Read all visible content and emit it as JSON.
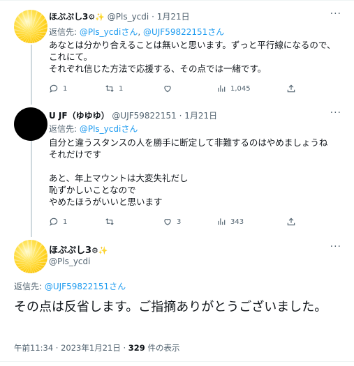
{
  "tweets": [
    {
      "name": "ほぷぷし3",
      "name_deco": "⚙✨",
      "handle": "@Pls_ycdi",
      "dot": "·",
      "time": "1月21日",
      "reply_prefix": "返信先: ",
      "reply_to_1": "@Pls_ycdiさん",
      "reply_sep": ", ",
      "reply_to_2": "@UJF59822151さん",
      "body": "あなとは分かり合えることは無いと思います。ずっと平行線になるので、\nこれにて。\nそれぞれ信じた方法で応援する、その点では一緒です。",
      "replies": "1",
      "retweets": "1",
      "likes": "",
      "views": "1,045"
    },
    {
      "name": "U JF（ゆゆゆ）",
      "handle": "@UJF59822151",
      "dot": "·",
      "time": "1月21日",
      "reply_prefix": "返信先: ",
      "reply_to_1": "@Pls_ycdiさん",
      "body": "自分と違うスタンスの人を勝手に断定して非難するのはやめましょうね\nそれだけです\n\nあと、年上マウントは大変失礼だし\n恥ずかしいことなので\nやめたほうがいいと思います",
      "replies": "1",
      "retweets": "",
      "likes": "3",
      "views": "343"
    }
  ],
  "main": {
    "name": "ほぷぷし3",
    "name_deco": "⚙✨",
    "handle": "@Pls_ycdi",
    "reply_prefix": "返信先: ",
    "reply_to": "@UJF59822151さん",
    "body": "その点は反省します。ご指摘ありがとうございました。",
    "meta_time": "午前11:34 · 2023年1月21日 · ",
    "meta_views_count": "329",
    "meta_views_label": " 件の表示"
  },
  "icons": {
    "more": "more-dots-icon",
    "reply": "reply-bubble-icon",
    "retweet": "retweet-icon",
    "like": "heart-icon",
    "views": "bar-chart-icon",
    "share": "share-upload-icon"
  },
  "colors": {
    "link": "#1d9bf0",
    "secondary": "#536471",
    "text": "#0f1419",
    "thread_line": "#cfd9de"
  }
}
